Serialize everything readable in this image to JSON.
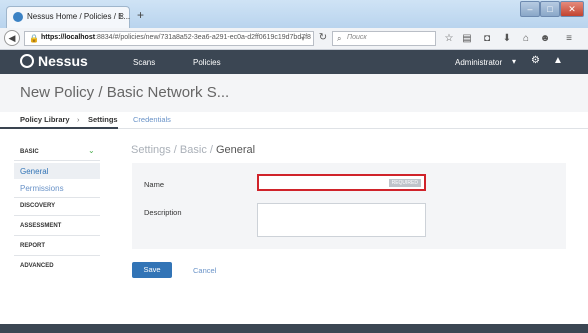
{
  "browser": {
    "tab_title": "Nessus Home / Policies / E...",
    "tab_close": "×",
    "new_tab": "+",
    "url_host": "https://localhost",
    "url_rest": ":8834/#/policies/new/731a8a52-3ea6-a291-ec0a-d2ff0619c19d7bd7f8",
    "search_placeholder": "Поиск",
    "window_min": "–",
    "window_max": "□",
    "window_close": "✕"
  },
  "app": {
    "logo": "Nessus",
    "nav": [
      "Scans",
      "Policies"
    ],
    "user": "Administrator"
  },
  "page": {
    "title": "New Policy / Basic Network S..."
  },
  "crumbs": {
    "library": "Policy Library",
    "sep": "›",
    "settings": "Settings",
    "credentials": "Credentials"
  },
  "sidebar": {
    "basic": "BASIC",
    "general": "General",
    "permissions": "Permissions",
    "discovery": "DISCOVERY",
    "assessment": "ASSESSMENT",
    "report": "REPORT",
    "advanced": "ADVANCED"
  },
  "main": {
    "heading_prefix": "Settings / Basic / ",
    "heading_current": "General",
    "name_label": "Name",
    "name_value": "",
    "required_badge": "REQUIRED",
    "description_label": "Description",
    "description_value": "",
    "save": "Save",
    "cancel": "Cancel"
  },
  "icons": {
    "back": "arrow-left-icon",
    "lock": "lock-icon",
    "reload": "reload-icon",
    "search": "search-icon",
    "star": "star-icon",
    "gear": "gear-icon",
    "bell": "bell-icon"
  },
  "colors": {
    "header": "#3b4653",
    "accent": "#3274b6",
    "error_border": "#d0232a",
    "link": "#6a93c8"
  }
}
